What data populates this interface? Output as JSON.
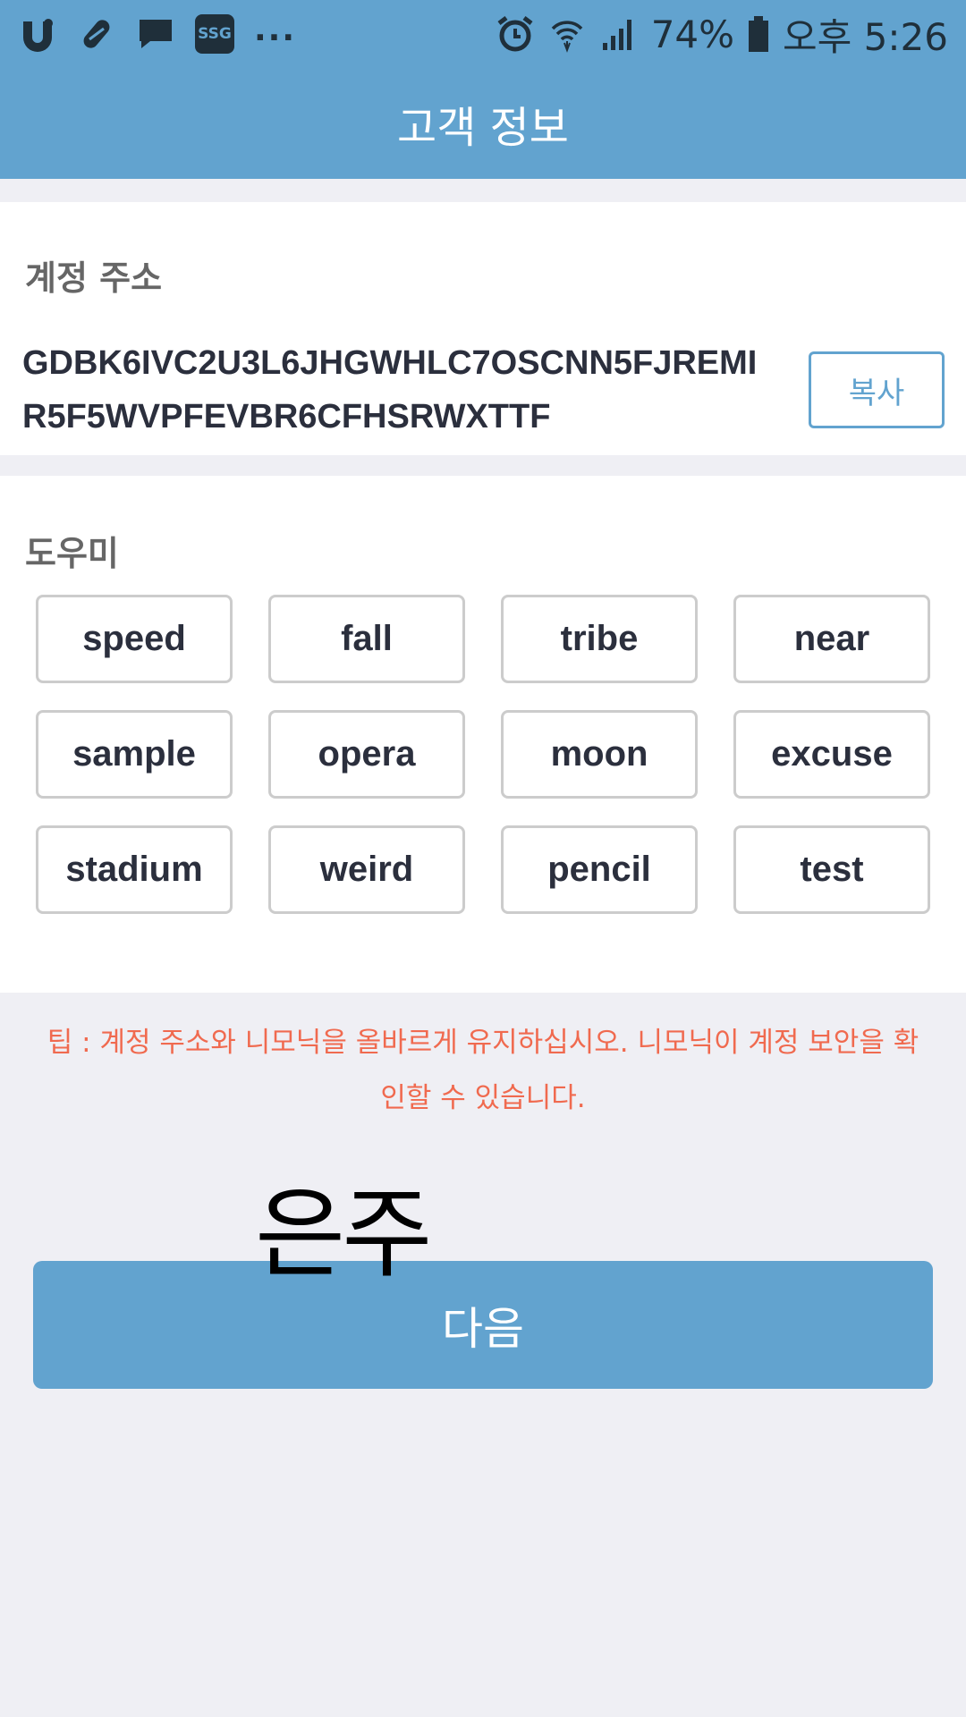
{
  "status_bar": {
    "battery": "74%",
    "time": "오후 5:26",
    "left_icons": [
      "uplus-icon",
      "pill-icon",
      "chat-bubble-icon",
      "ssg-icon"
    ],
    "ssg_label": "SSG",
    "overflow": "...",
    "right_icons": [
      "alarm-icon",
      "wifi-icon",
      "signal-icon",
      "battery-icon"
    ]
  },
  "header": {
    "title": "고객 정보"
  },
  "account": {
    "label": "계정 주소",
    "address": "GDBK6IVC2U3L6JHGWHLC7OSCNN5FJREMIR5F5WVPFEVBR6CFHSRWXTTF",
    "copy_label": "복사"
  },
  "mnemonic": {
    "label": "도우미",
    "words": [
      "speed",
      "fall",
      "tribe",
      "near",
      "sample",
      "opera",
      "moon",
      "excuse",
      "stadium",
      "weird",
      "pencil",
      "test"
    ]
  },
  "tip": "팁 : 계정 주소와 니모닉을 올바르게 유지하십시오. 니모닉이 계정 보안을 확인할 수 있습니다.",
  "overlay_text": "은주",
  "next_label": "다음",
  "colors": {
    "primary": "#62a3cf",
    "tip": "#f06a4f",
    "background": "#efeff4",
    "text_dark": "#2b2f3d"
  }
}
